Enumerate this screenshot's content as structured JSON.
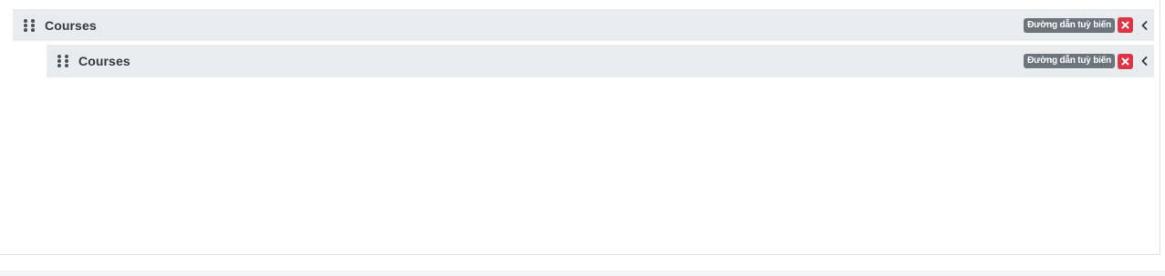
{
  "menu": {
    "items": [
      {
        "title": "Courses",
        "badge": "Đường dẫn tuỳ biến",
        "level": 0
      },
      {
        "title": "Courses",
        "badge": "Đường dẫn tuỳ biến",
        "level": 1
      }
    ]
  },
  "icons": {
    "drag": "drag-handle-icon",
    "remove": "close-icon",
    "toggle": "chevron-left-icon"
  },
  "colors": {
    "item_bg": "#e9ecef",
    "badge_bg": "#6c757d",
    "remove_bg": "#dc3545",
    "text": "#343a40"
  }
}
